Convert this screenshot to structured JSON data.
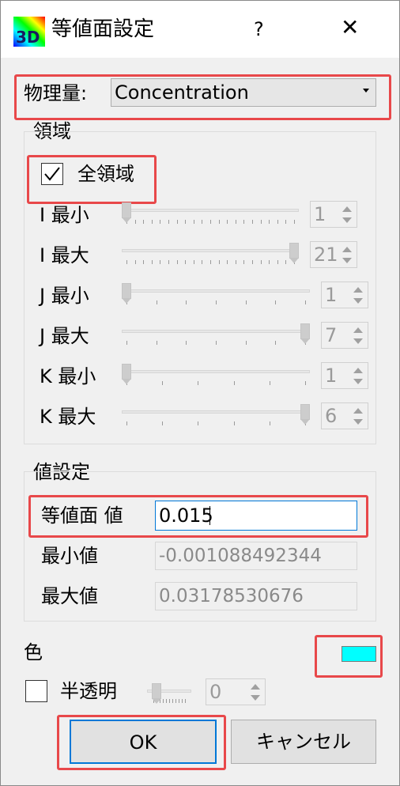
{
  "window": {
    "title": "等値面設定",
    "help_label": "?",
    "close_label": "✕",
    "app_icon_text": "3D"
  },
  "physical_quantity": {
    "label": "物理量:",
    "selected": "Concentration"
  },
  "region": {
    "group_label": "領域",
    "all_region_label": "全領域",
    "all_region_checked": true,
    "rows": [
      {
        "label": "I 最小",
        "value": "1",
        "fraction": 0.0,
        "ticks": 21
      },
      {
        "label": "I 最大",
        "value": "21",
        "fraction": 1.0,
        "ticks": 21
      },
      {
        "label": "J 最小",
        "value": "1",
        "fraction": 0.0,
        "ticks": 7
      },
      {
        "label": "J 最大",
        "value": "7",
        "fraction": 1.0,
        "ticks": 7
      },
      {
        "label": "K 最小",
        "value": "1",
        "fraction": 0.0,
        "ticks": 6
      },
      {
        "label": "K 最大",
        "value": "6",
        "fraction": 1.0,
        "ticks": 6
      }
    ]
  },
  "value_setting": {
    "group_label": "値設定",
    "iso_label": "等値面 値",
    "iso_value": "0.015",
    "min_label": "最小値",
    "min_value": "-0.001088492344",
    "max_label": "最大値",
    "max_value": "0.03178530676"
  },
  "color": {
    "label": "色",
    "swatch": "#00ffff",
    "translucent_label": "半透明",
    "translucent_checked": false,
    "translucent_value": "0",
    "translucent_fraction": 0.0
  },
  "buttons": {
    "ok": "OK",
    "cancel": "キャンセル"
  },
  "highlight_color": "#e8484a"
}
